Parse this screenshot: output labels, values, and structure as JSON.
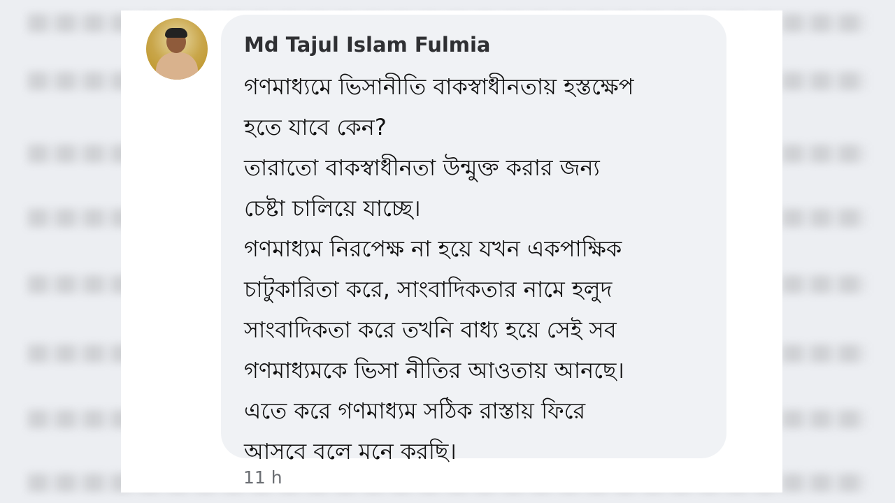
{
  "comment": {
    "author": "Md Tajul Islam Fulmia",
    "text_lines": [
      "গণমাধ্যমে ভিসানীতি বাকস্বাধীনতায় হস্তক্ষেপ",
      "হতে যাবে কেন?",
      "তারাতো বাকস্বাধীনতা উন্মুক্ত করার জন্য",
      "চেষ্টা চালিয়ে যাচ্ছে।",
      "গণমাধ্যম নিরপেক্ষ না হয়ে যখন একপাক্ষিক",
      "চাটুকারিতা করে, সাংবাদিকতার নামে হলুদ",
      "সাংবাদিকতা করে তখনি বাধ্য হয়ে সেই সব",
      "গণমাধ্যমকে ভিসা নীতির আওতায় আনছে।",
      "এতে করে গণমাধ্যম সঠিক রাস্তায় ফিরে",
      "আসবে বলে মনে করছি।"
    ],
    "timestamp": "11 h"
  },
  "colors": {
    "bubble_background": "#f0f2f5",
    "author_text": "#2f3033",
    "body_text": "#111111",
    "timestamp_text": "#6a6d72"
  }
}
